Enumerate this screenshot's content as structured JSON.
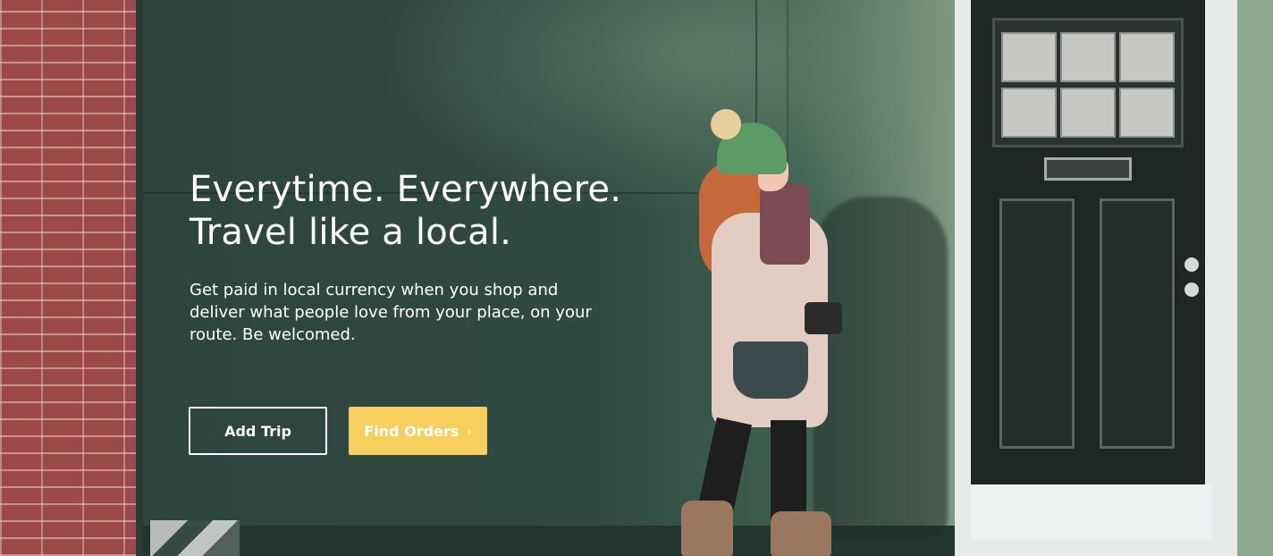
{
  "hero": {
    "title": "Everytime. Everywhere.\nTravel like a local.",
    "subtitle": "Get paid in local currency when you shop and deliver what people love from your place, on your route. Be welcomed."
  },
  "actions": {
    "add_trip_label": "Add Trip",
    "find_orders_label": "Find Orders",
    "find_orders_icon": "chevron-right-icon"
  },
  "colors": {
    "accent": "#f6cf5e",
    "text": "#ffffff",
    "wall": "#2f4740"
  }
}
